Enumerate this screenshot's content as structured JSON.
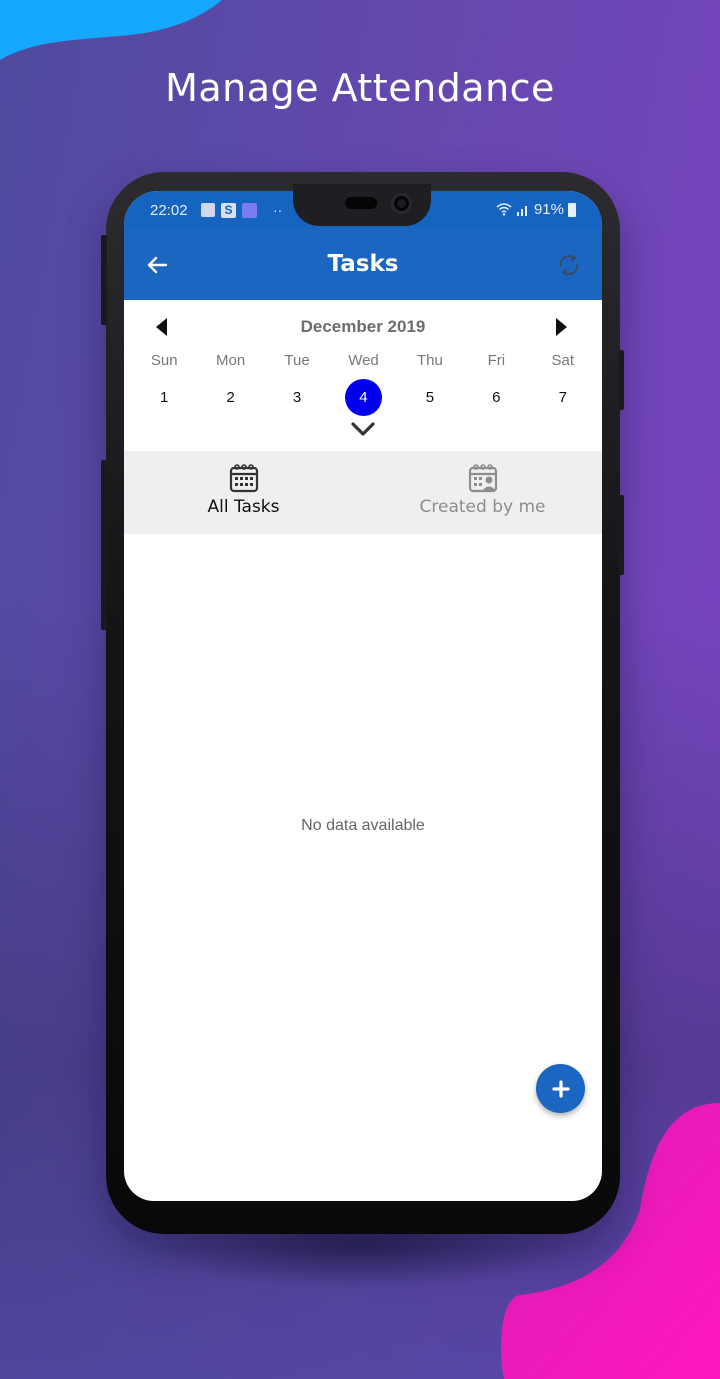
{
  "hero": {
    "title": "Manage Attendance"
  },
  "colors": {
    "primary": "#1a66c1",
    "status_bar": "#1565c0",
    "selected_day": "#0000ee",
    "tab_bg": "#efefef",
    "blob_top": "#16a7ff",
    "blob_bottom": "#f01bbf"
  },
  "status_bar": {
    "time": "22:02",
    "notification_icons": [
      "multi-window-icon",
      "s-app-icon",
      "gallery-app-icon",
      "more-dots-icon"
    ],
    "more_indicator": "··",
    "battery": "91%",
    "status_icons": [
      "wifi-icon",
      "signal-icon",
      "battery-icon"
    ]
  },
  "app_bar": {
    "title": "Tasks",
    "back_icon": "arrow-left-icon",
    "refresh_icon": "refresh-icon"
  },
  "calendar": {
    "month_label": "December 2019",
    "weekdays": [
      "Sun",
      "Mon",
      "Tue",
      "Wed",
      "Thu",
      "Fri",
      "Sat"
    ],
    "days": [
      "1",
      "2",
      "3",
      "4",
      "5",
      "6",
      "7"
    ],
    "selected_day": "4"
  },
  "tabs": [
    {
      "label": "All Tasks",
      "icon": "calendar-icon",
      "active": true
    },
    {
      "label": "Created by me",
      "icon": "calendar-user-icon",
      "active": false
    }
  ],
  "content": {
    "empty_message": "No data available"
  },
  "fab": {
    "icon": "plus-icon",
    "label": "+"
  }
}
